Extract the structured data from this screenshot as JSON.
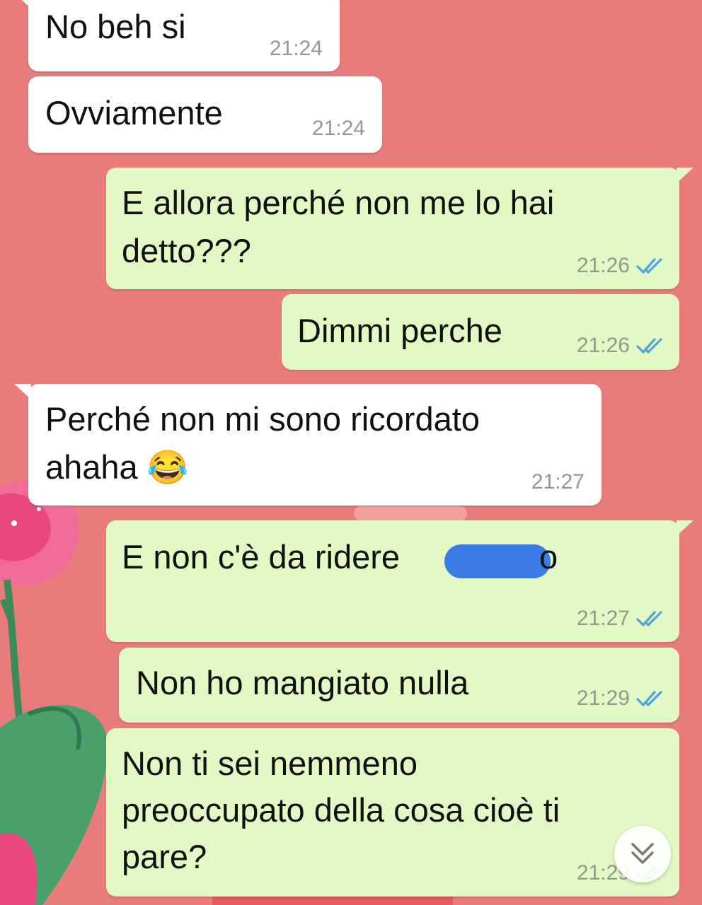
{
  "messages": [
    {
      "direction": "in",
      "text": "No beh si",
      "time": "21:24"
    },
    {
      "direction": "in",
      "text": "Ovviamente",
      "time": "21:24"
    },
    {
      "direction": "out",
      "text_line1": "E allora perché non me lo hai",
      "text_line2": "detto???",
      "time": "21:26",
      "status": "read"
    },
    {
      "direction": "out",
      "text": "Dimmi perche",
      "time": "21:26",
      "status": "read"
    },
    {
      "direction": "in",
      "text_line1": "Perché non mi sono ricordato",
      "text_line2": "ahaha",
      "emoji": "😂",
      "time": "21:27"
    },
    {
      "direction": "out",
      "text": "E non c'è da ridere",
      "trailing": "o",
      "time": "21:27",
      "status": "read",
      "redacted": true
    },
    {
      "direction": "out",
      "text": "Non ho mangiato nulla",
      "time": "21:29",
      "status": "read"
    },
    {
      "direction": "out",
      "text_line1": "Non ti sei nemmeno",
      "text_line2": "preoccupato della cosa cioè ti",
      "text_line3": "pare?",
      "time": "21:29",
      "status": "read"
    }
  ],
  "colors": {
    "background": "#e87b7b",
    "incoming_bubble": "#ffffff",
    "outgoing_bubble": "#e2f8c5",
    "read_ticks": "#4fa3e0",
    "timestamp": "#8e9a8e"
  },
  "icons": {
    "read_receipt": "double-check-icon",
    "scroll_down": "chevron-double-down-icon"
  }
}
